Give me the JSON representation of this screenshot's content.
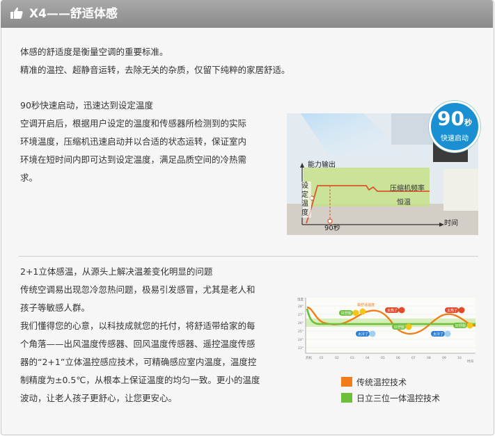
{
  "header": {
    "title": "X4——舒适体感"
  },
  "section1": {
    "lines": [
      "体感的舒适度是衡量空调的重要标准。",
      "精准的温控、超静音运转，去除无关的杂质，仅留下纯粹的家居舒适。"
    ]
  },
  "section2": {
    "heading": "90秒快速启动，迅速达到设定温度",
    "lines": [
      "空调开启后，根据用户设定的温度和传感器所检测到的实际",
      "环境温度，压缩机迅速启动并以合适的状态运转，保证室内",
      "环境在短时间内即可达到设定温度，满足品质空间的冷热需",
      "求。"
    ]
  },
  "badge": {
    "number": "90",
    "unit": "秒",
    "caption": "快速启动"
  },
  "diagram1": {
    "y_axis": "能力输出",
    "x_axis": "时间",
    "setpoint_label": "设定温度",
    "freq_label": "压缩机频率",
    "constant_label": "恒温",
    "time_mark": "90秒"
  },
  "section3": {
    "heading": "2+1立体感温，从源头上解决温差变化明显的问题",
    "lines": [
      "传统空调易出现忽冷忽热问题，极易引发感冒，尤其是老人和",
      "孩子等敏感人群。",
      "我们懂得您的心意，以科技成就您的托付，将舒适带给家的每",
      "个角落——出风温度传感器、回风温度传感器、遥控温度传感",
      "器的“2+1”立体温控感应技术，可精确感应室内温度，温度控",
      "制精度为±0.5℃，从根本上保证温度的均匀一致。更小的温度",
      "波动，让老人孩子更舒心，让您更安心。"
    ]
  },
  "diagram2": {
    "y_title": "温度",
    "x_title": "时间",
    "y_ticks": [
      "28°",
      "27°",
      "26°",
      "25°",
      "24°",
      "23°"
    ],
    "x_ticks": [
      "开机",
      "01",
      "02",
      "03",
      "04",
      "05",
      "06",
      "07",
      "08",
      "09",
      "10"
    ],
    "bubbles": [
      "最舒适温度",
      "太热了",
      "好舒服",
      "太冷了",
      "好舒服",
      "太热了",
      "太冷了",
      "好舒服"
    ]
  },
  "legend": [
    {
      "label": "传统温控技术",
      "color": "#f07d1a"
    },
    {
      "label": "日立三位一体温控技术",
      "color": "#6cbf3b"
    }
  ]
}
